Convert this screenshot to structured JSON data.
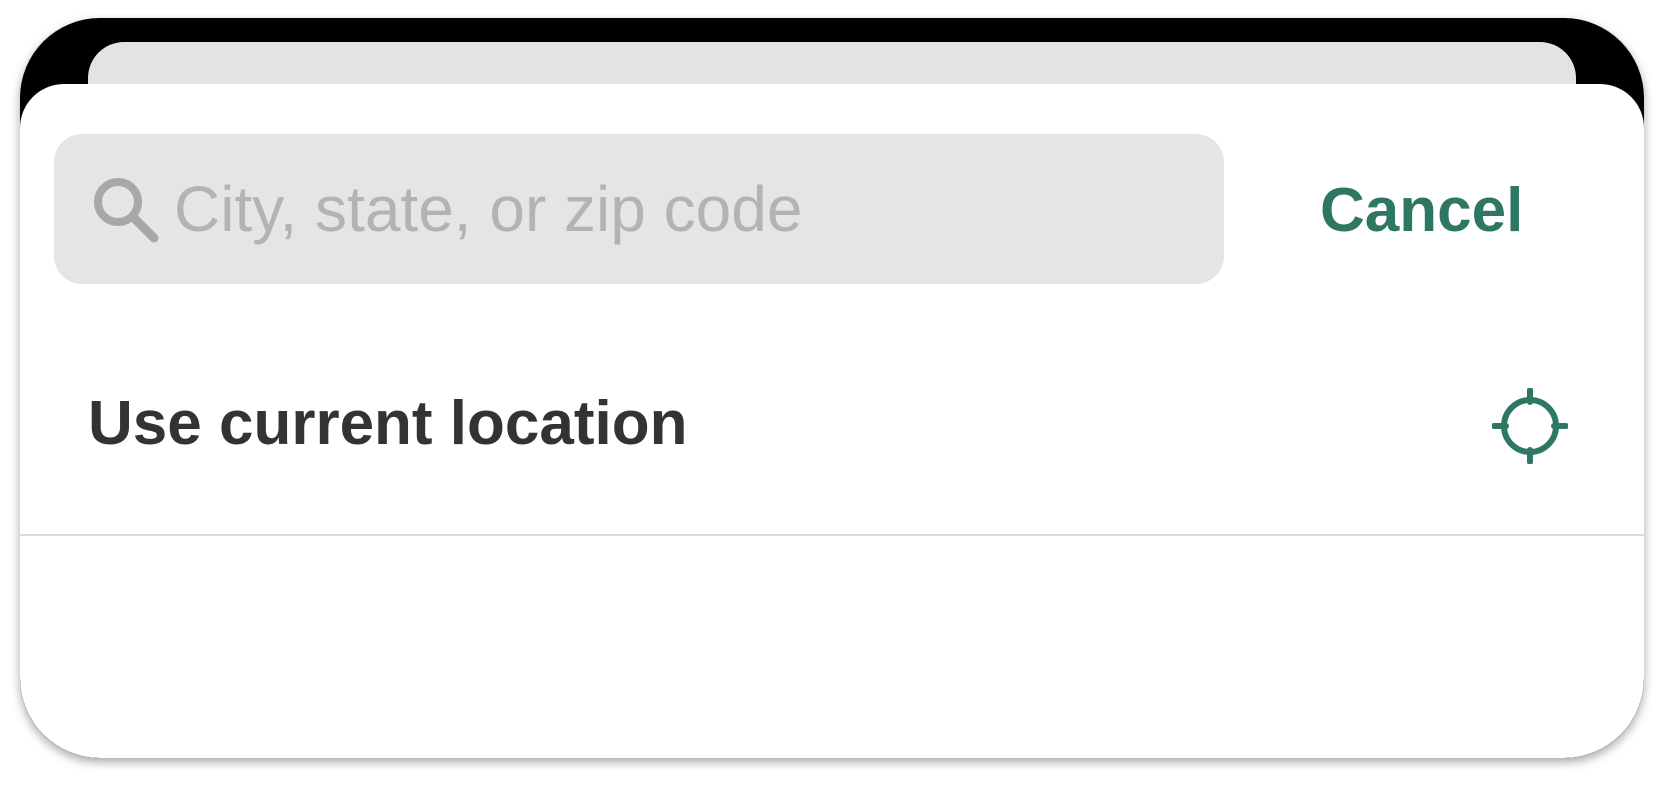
{
  "search": {
    "placeholder": "City, state, or zip code",
    "value": "",
    "icon": "search-icon"
  },
  "header": {
    "cancel_label": "Cancel"
  },
  "location": {
    "label": "Use current location",
    "icon": "crosshair-icon"
  },
  "colors": {
    "accent": "#2e7765",
    "field_background": "#e5e5e5",
    "placeholder": "#b3b3b3",
    "text": "#333333",
    "divider": "#d9d9d9"
  }
}
